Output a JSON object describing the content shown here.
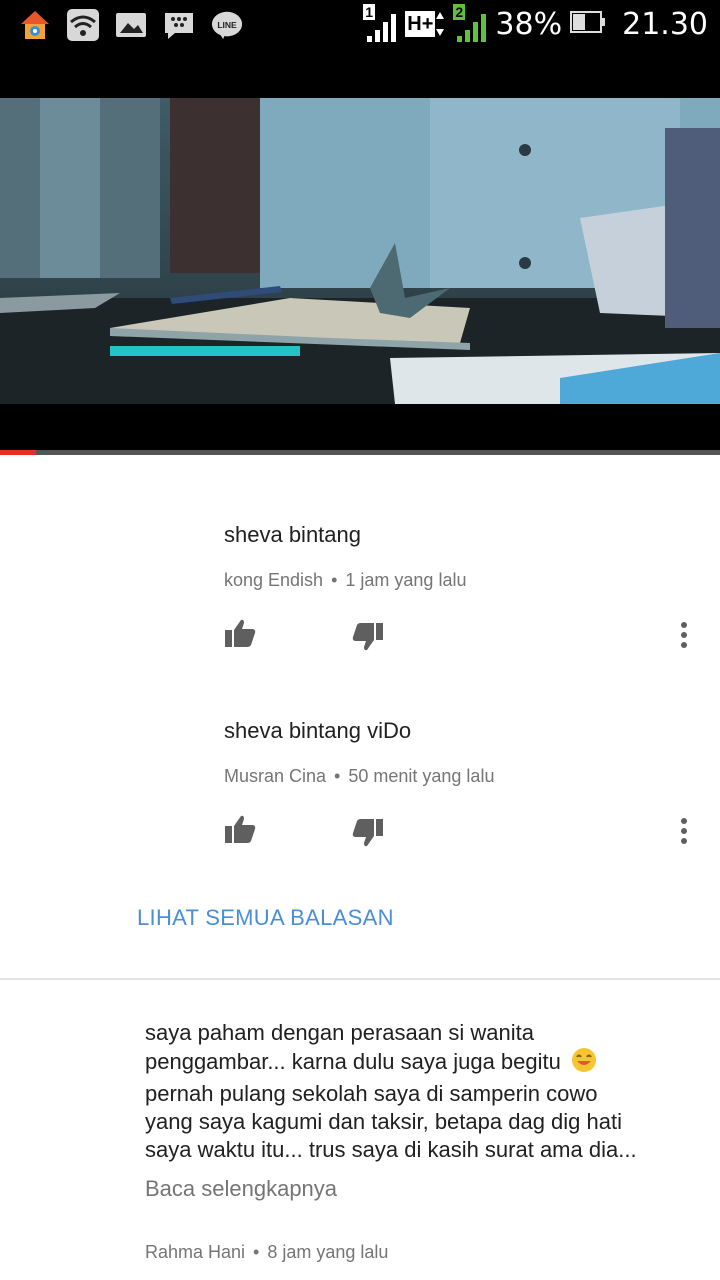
{
  "status_bar": {
    "battery_percent": "38%",
    "time": "21.30",
    "network_type": "H+",
    "sim1_label": "1",
    "sim2_label": "2",
    "notification_icons": [
      "home-launcher-icon",
      "wifi-icon",
      "gallery-icon",
      "bbm-icon",
      "line-icon"
    ],
    "line_icon_text": "LINE"
  },
  "video": {
    "progress": 0.05,
    "accent_color": "#e52d27"
  },
  "replies": [
    {
      "text": "sheva bintang",
      "author": "kong Endish",
      "time": "1 jam yang lalu"
    },
    {
      "text": "sheva bintang  viDo",
      "author": "Musran Cina",
      "time": "50 menit yang lalu"
    }
  ],
  "see_all_replies": "LIHAT SEMUA BALASAN",
  "comment": {
    "lines": [
      "saya paham dengan perasaan si wanita",
      "penggambar... karna dulu saya juga begitu",
      "pernah pulang sekolah saya di samperin cowo",
      "yang saya kagumi dan taksir, betapa dag dig hati",
      "saya waktu itu... trus saya di kasih surat ama dia..."
    ],
    "read_more": "Baca selengkapnya",
    "author": "Rahma Hani",
    "time": "8 jam yang lalu"
  },
  "meta_separator": "•"
}
